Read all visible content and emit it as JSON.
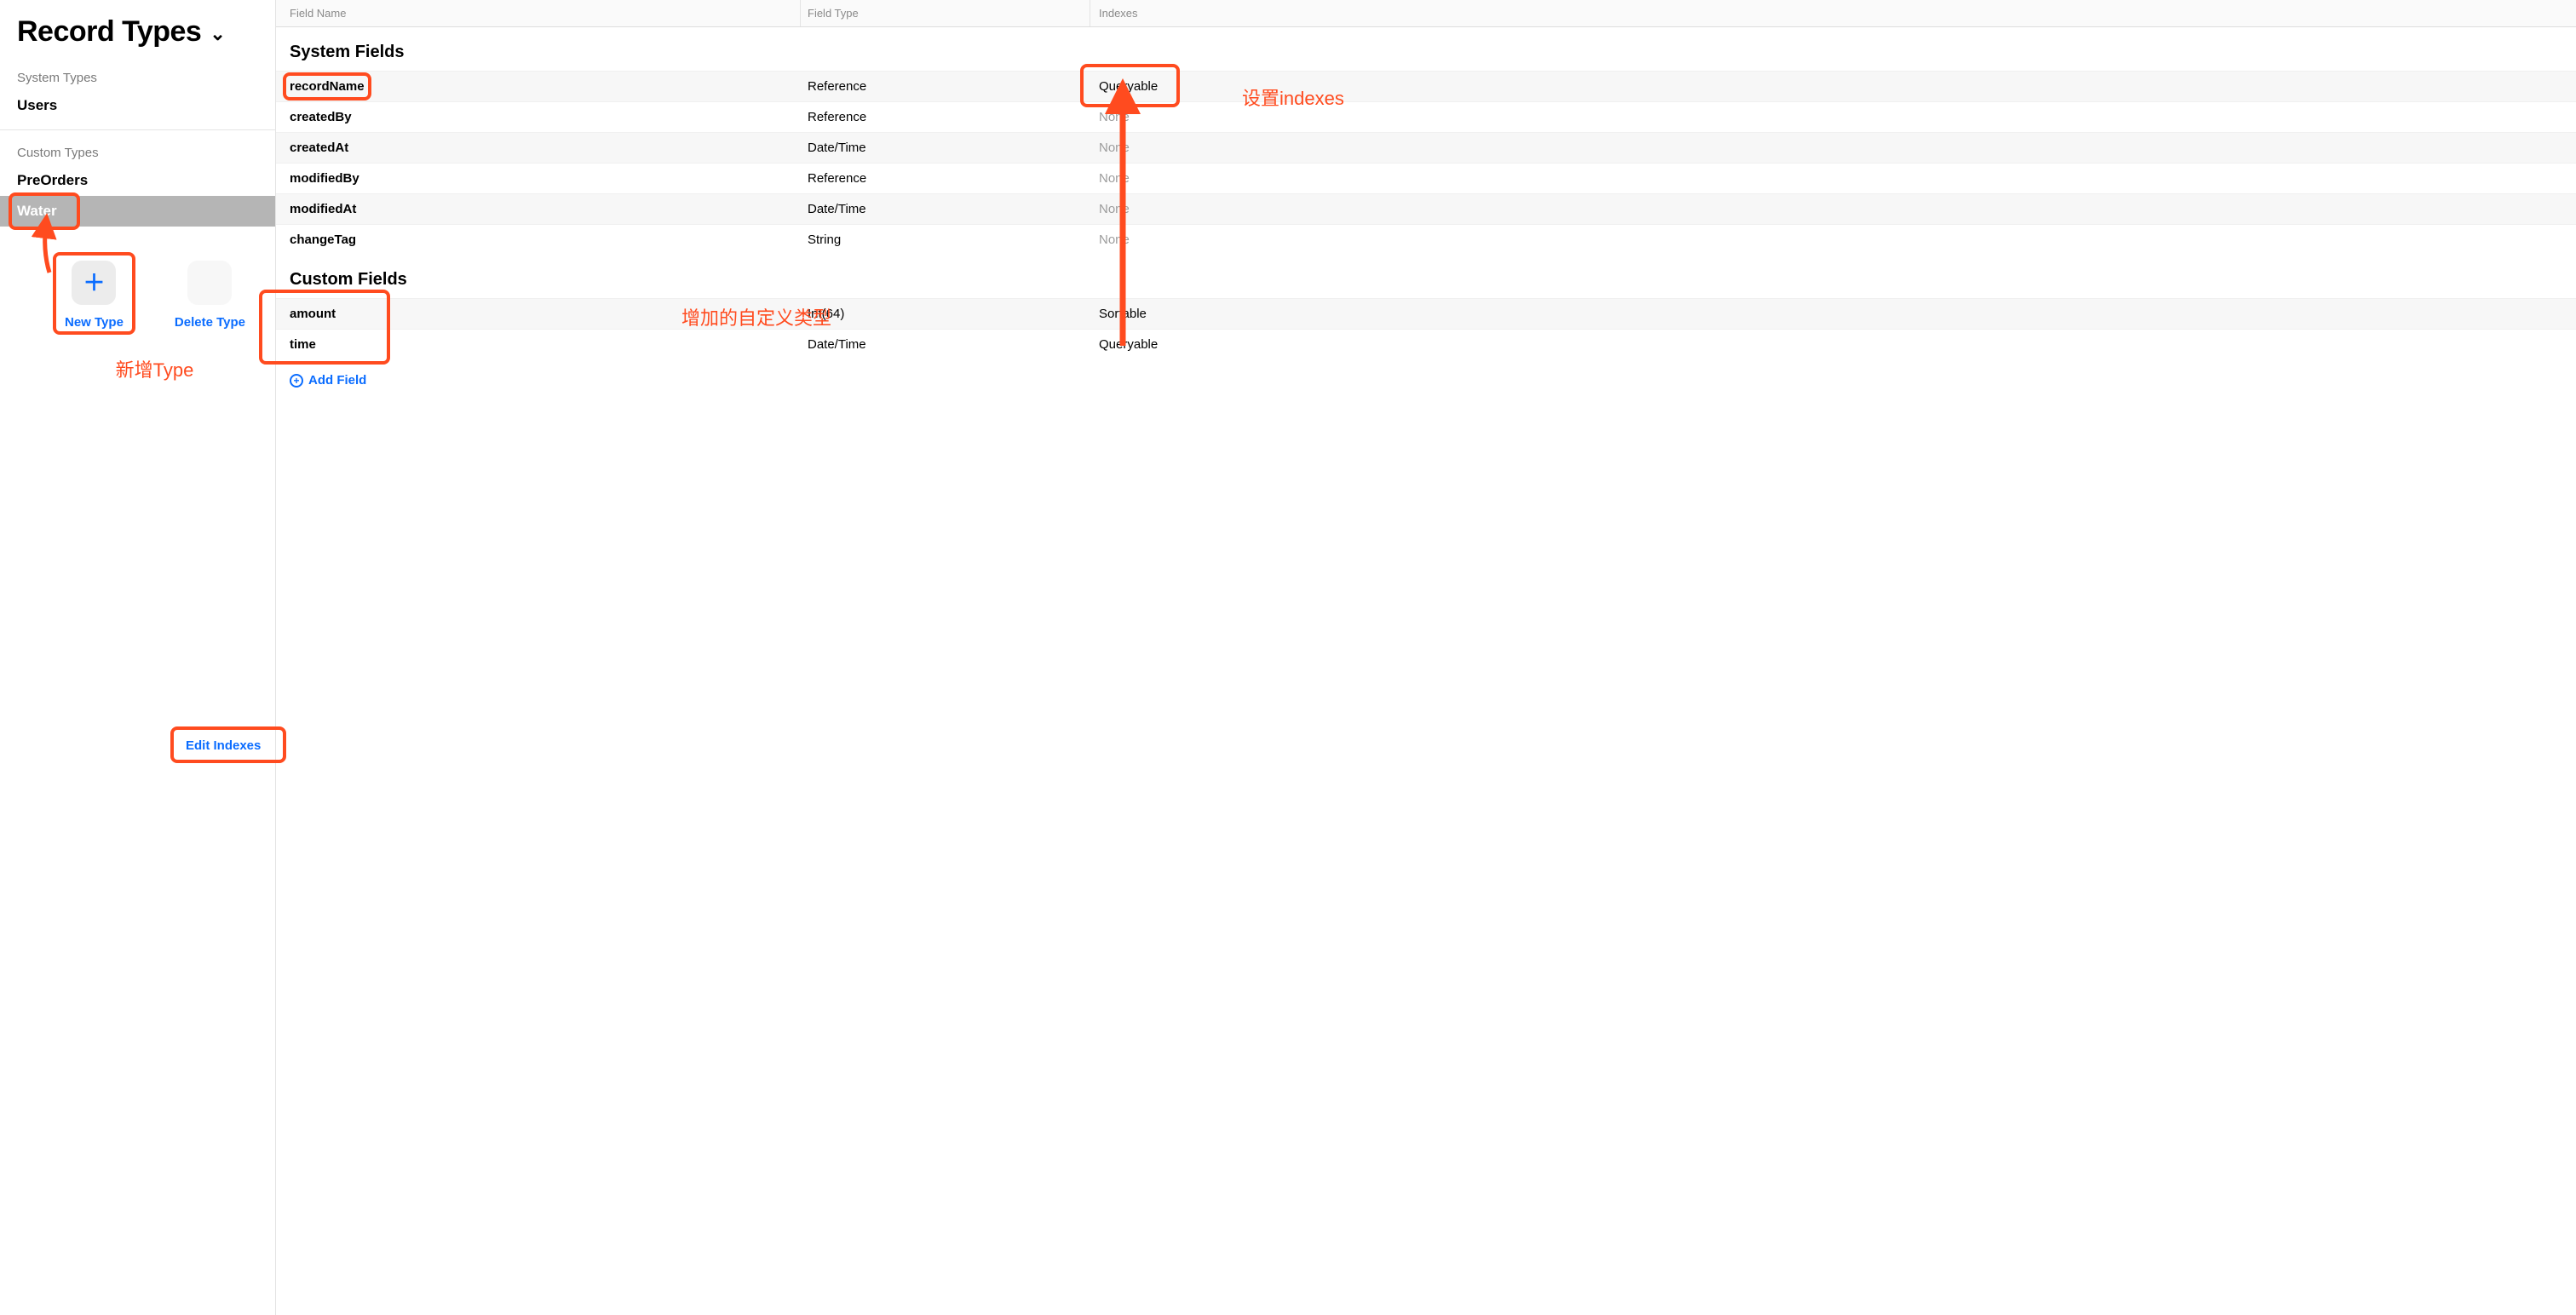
{
  "sidebar": {
    "title": "Record Types",
    "system_types_label": "System Types",
    "system_types": [
      "Users"
    ],
    "custom_types_label": "Custom Types",
    "custom_types": [
      "PreOrders",
      "Water"
    ],
    "selected": "Water",
    "new_type_label": "New Type",
    "delete_type_label": "Delete Type"
  },
  "columns": {
    "name": "Field Name",
    "type": "Field Type",
    "indexes": "Indexes"
  },
  "system_fields_title": "System Fields",
  "system_fields": [
    {
      "name": "recordName",
      "type": "Reference",
      "indexes": "Queryable"
    },
    {
      "name": "createdBy",
      "type": "Reference",
      "indexes": "None"
    },
    {
      "name": "createdAt",
      "type": "Date/Time",
      "indexes": "None"
    },
    {
      "name": "modifiedBy",
      "type": "Reference",
      "indexes": "None"
    },
    {
      "name": "modifiedAt",
      "type": "Date/Time",
      "indexes": "None"
    },
    {
      "name": "changeTag",
      "type": "String",
      "indexes": "None"
    }
  ],
  "custom_fields_title": "Custom Fields",
  "custom_fields": [
    {
      "name": "amount",
      "type": "Int(64)",
      "indexes": "Sortable"
    },
    {
      "name": "time",
      "type": "Date/Time",
      "indexes": "Queryable"
    }
  ],
  "add_field_label": "Add Field",
  "edit_indexes_label": "Edit Indexes",
  "annotations": {
    "new_type": "新增Type",
    "custom_fields": "增加的自定义类型",
    "indexes": "设置indexes"
  }
}
